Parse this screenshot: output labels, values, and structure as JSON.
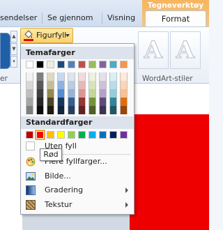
{
  "tabs": {
    "context_group": "Tegneverktøy",
    "items": [
      "sendelser",
      "Se gjennom",
      "Visning"
    ],
    "active": "Format"
  },
  "ribbon": {
    "shape_fill_button": "Figurfyll",
    "wordart_group_label": "WordArt-stiler",
    "left_group_label": "er",
    "wordart_letter": "A"
  },
  "menu": {
    "theme_colors_header": "Temafarger",
    "theme_top_row": [
      "#ffffff",
      "#000000",
      "#eeece1",
      "#1f497d",
      "#4f81bd",
      "#c0504d",
      "#9bbb59",
      "#8064a2",
      "#4bacc6",
      "#f79646"
    ],
    "theme_shades": [
      [
        "#f2f2f2",
        "#7f7f7f",
        "#ddd9c3",
        "#c6d9f0",
        "#dbe5f1",
        "#f2dcdb",
        "#ebf1dd",
        "#e5e0ec",
        "#dbeef3",
        "#fdeada"
      ],
      [
        "#d8d8d8",
        "#595959",
        "#c4bd97",
        "#8db3e2",
        "#b8cce4",
        "#e5b9b7",
        "#d7e3bc",
        "#ccc1d9",
        "#b7dde8",
        "#fbd5b5"
      ],
      [
        "#bfbfbf",
        "#3f3f3f",
        "#938953",
        "#548dd4",
        "#95b3d7",
        "#d99694",
        "#c3d69b",
        "#b2a2c7",
        "#92cddc",
        "#fac08f"
      ],
      [
        "#a5a5a5",
        "#262626",
        "#494429",
        "#17365d",
        "#366092",
        "#953734",
        "#76923c",
        "#5f497a",
        "#31859b",
        "#e36c09"
      ],
      [
        "#7f7f7f",
        "#0c0c0c",
        "#1d1b10",
        "#0f243e",
        "#244061",
        "#632423",
        "#4f6128",
        "#3f3151",
        "#205867",
        "#974806"
      ]
    ],
    "standard_colors_header": "Standardfarger",
    "standard_colors": [
      "#c00000",
      "#ff0000",
      "#ffc000",
      "#ffff00",
      "#92d050",
      "#00b050",
      "#00b0f0",
      "#0070c0",
      "#002060",
      "#7030a0"
    ],
    "selected_standard_index": 1,
    "no_fill": "Uten fyll",
    "more_colors": "Flere fyllfarger...",
    "picture": "Bilde...",
    "gradient": "Gradering",
    "texture": "Tekstur"
  },
  "tooltip": "Rød",
  "colors": {
    "slide_fill": "#ee0000",
    "accent_highlight": "#fbd26a"
  }
}
